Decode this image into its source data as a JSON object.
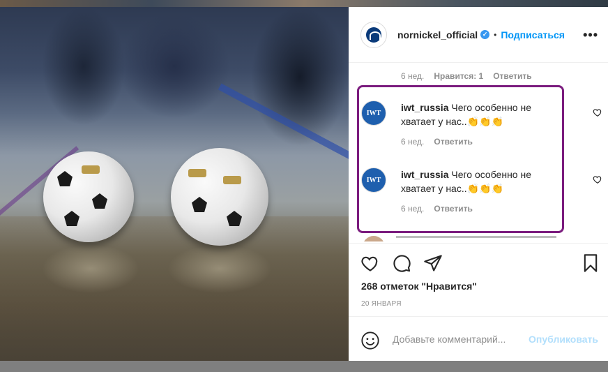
{
  "post": {
    "username": "nornickel_official",
    "verified_symbol": "✓",
    "dot": "•",
    "follow_label": "Подписаться",
    "more_label": "•••"
  },
  "previous_comment": {
    "age": "6 нед.",
    "likes": "Нравится: 1",
    "reply": "Ответить"
  },
  "comments": [
    {
      "avatar_text": "IWT",
      "username": "iwt_russia",
      "text": "Чего особенно не хватает у нас..👏👏👏",
      "age": "6 нед.",
      "reply": "Ответить"
    },
    {
      "avatar_text": "IWT",
      "username": "iwt_russia",
      "text": "Чего особенно не хватает у нас..👏👏👏",
      "age": "6 нед.",
      "reply": "Ответить"
    }
  ],
  "footer": {
    "likes_text": "268 отметок \"Нравится\"",
    "date": "20 ЯНВАРЯ",
    "add_comment_placeholder": "Добавьте комментарий...",
    "publish_label": "Опубликовать"
  },
  "colors": {
    "accent": "#0095f6",
    "highlight_border": "#7b1c7e",
    "publish_disabled": "#b2dffc"
  }
}
